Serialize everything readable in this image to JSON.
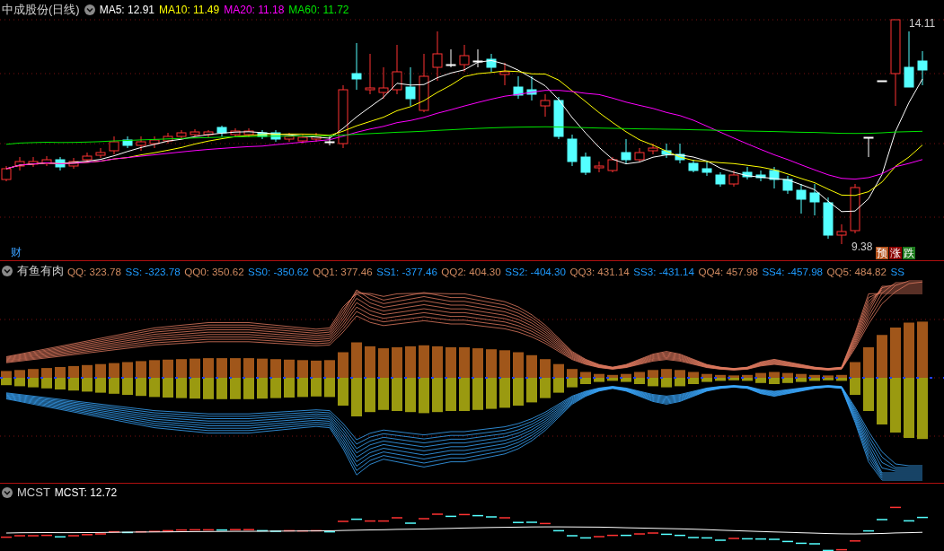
{
  "price_panel": {
    "title": "中成股份(日线)",
    "readings": [
      {
        "label": "MA5: 12.91",
        "color": "#ffffff"
      },
      {
        "label": "MA10: 11.49",
        "color": "#ffff00"
      },
      {
        "label": "MA20: 11.18",
        "color": "#ff00ff"
      },
      {
        "label": "MA60: 11.72",
        "color": "#00e600"
      }
    ],
    "high_label": "14.11",
    "low_label": "9.38",
    "finance_badge": "财",
    "forecast_buttons": [
      {
        "label": "预",
        "color": "#b5521b"
      },
      {
        "label": "涨",
        "color": "#8b0000"
      },
      {
        "label": "跌",
        "color": "#1d7a1d"
      }
    ]
  },
  "indicator_panel": {
    "title": "有鱼有肉",
    "readings": [
      {
        "label": "QQ: 323.78",
        "color": "#d08a60"
      },
      {
        "label": "SS: -323.78",
        "color": "#1e9bff"
      },
      {
        "label": "QQ0: 350.62",
        "color": "#d08a60"
      },
      {
        "label": "SS0: -350.62",
        "color": "#1e9bff"
      },
      {
        "label": "QQ1: 377.46",
        "color": "#d08a60"
      },
      {
        "label": "SS1: -377.46",
        "color": "#1e9bff"
      },
      {
        "label": "QQ2: 404.30",
        "color": "#d08a60"
      },
      {
        "label": "SS2: -404.30",
        "color": "#1e9bff"
      },
      {
        "label": "QQ3: 431.14",
        "color": "#d08a60"
      },
      {
        "label": "SS3: -431.14",
        "color": "#1e9bff"
      },
      {
        "label": "QQ4: 457.98",
        "color": "#d08a60"
      },
      {
        "label": "SS4: -457.98",
        "color": "#1e9bff"
      },
      {
        "label": "QQ5: 484.82",
        "color": "#d08a60"
      },
      {
        "label": "SS",
        "color": "#1e9bff"
      }
    ]
  },
  "cost_panel": {
    "title": "MCST",
    "readings": [
      {
        "label": "MCST: 12.72",
        "color": "#ffffff"
      }
    ]
  }
}
